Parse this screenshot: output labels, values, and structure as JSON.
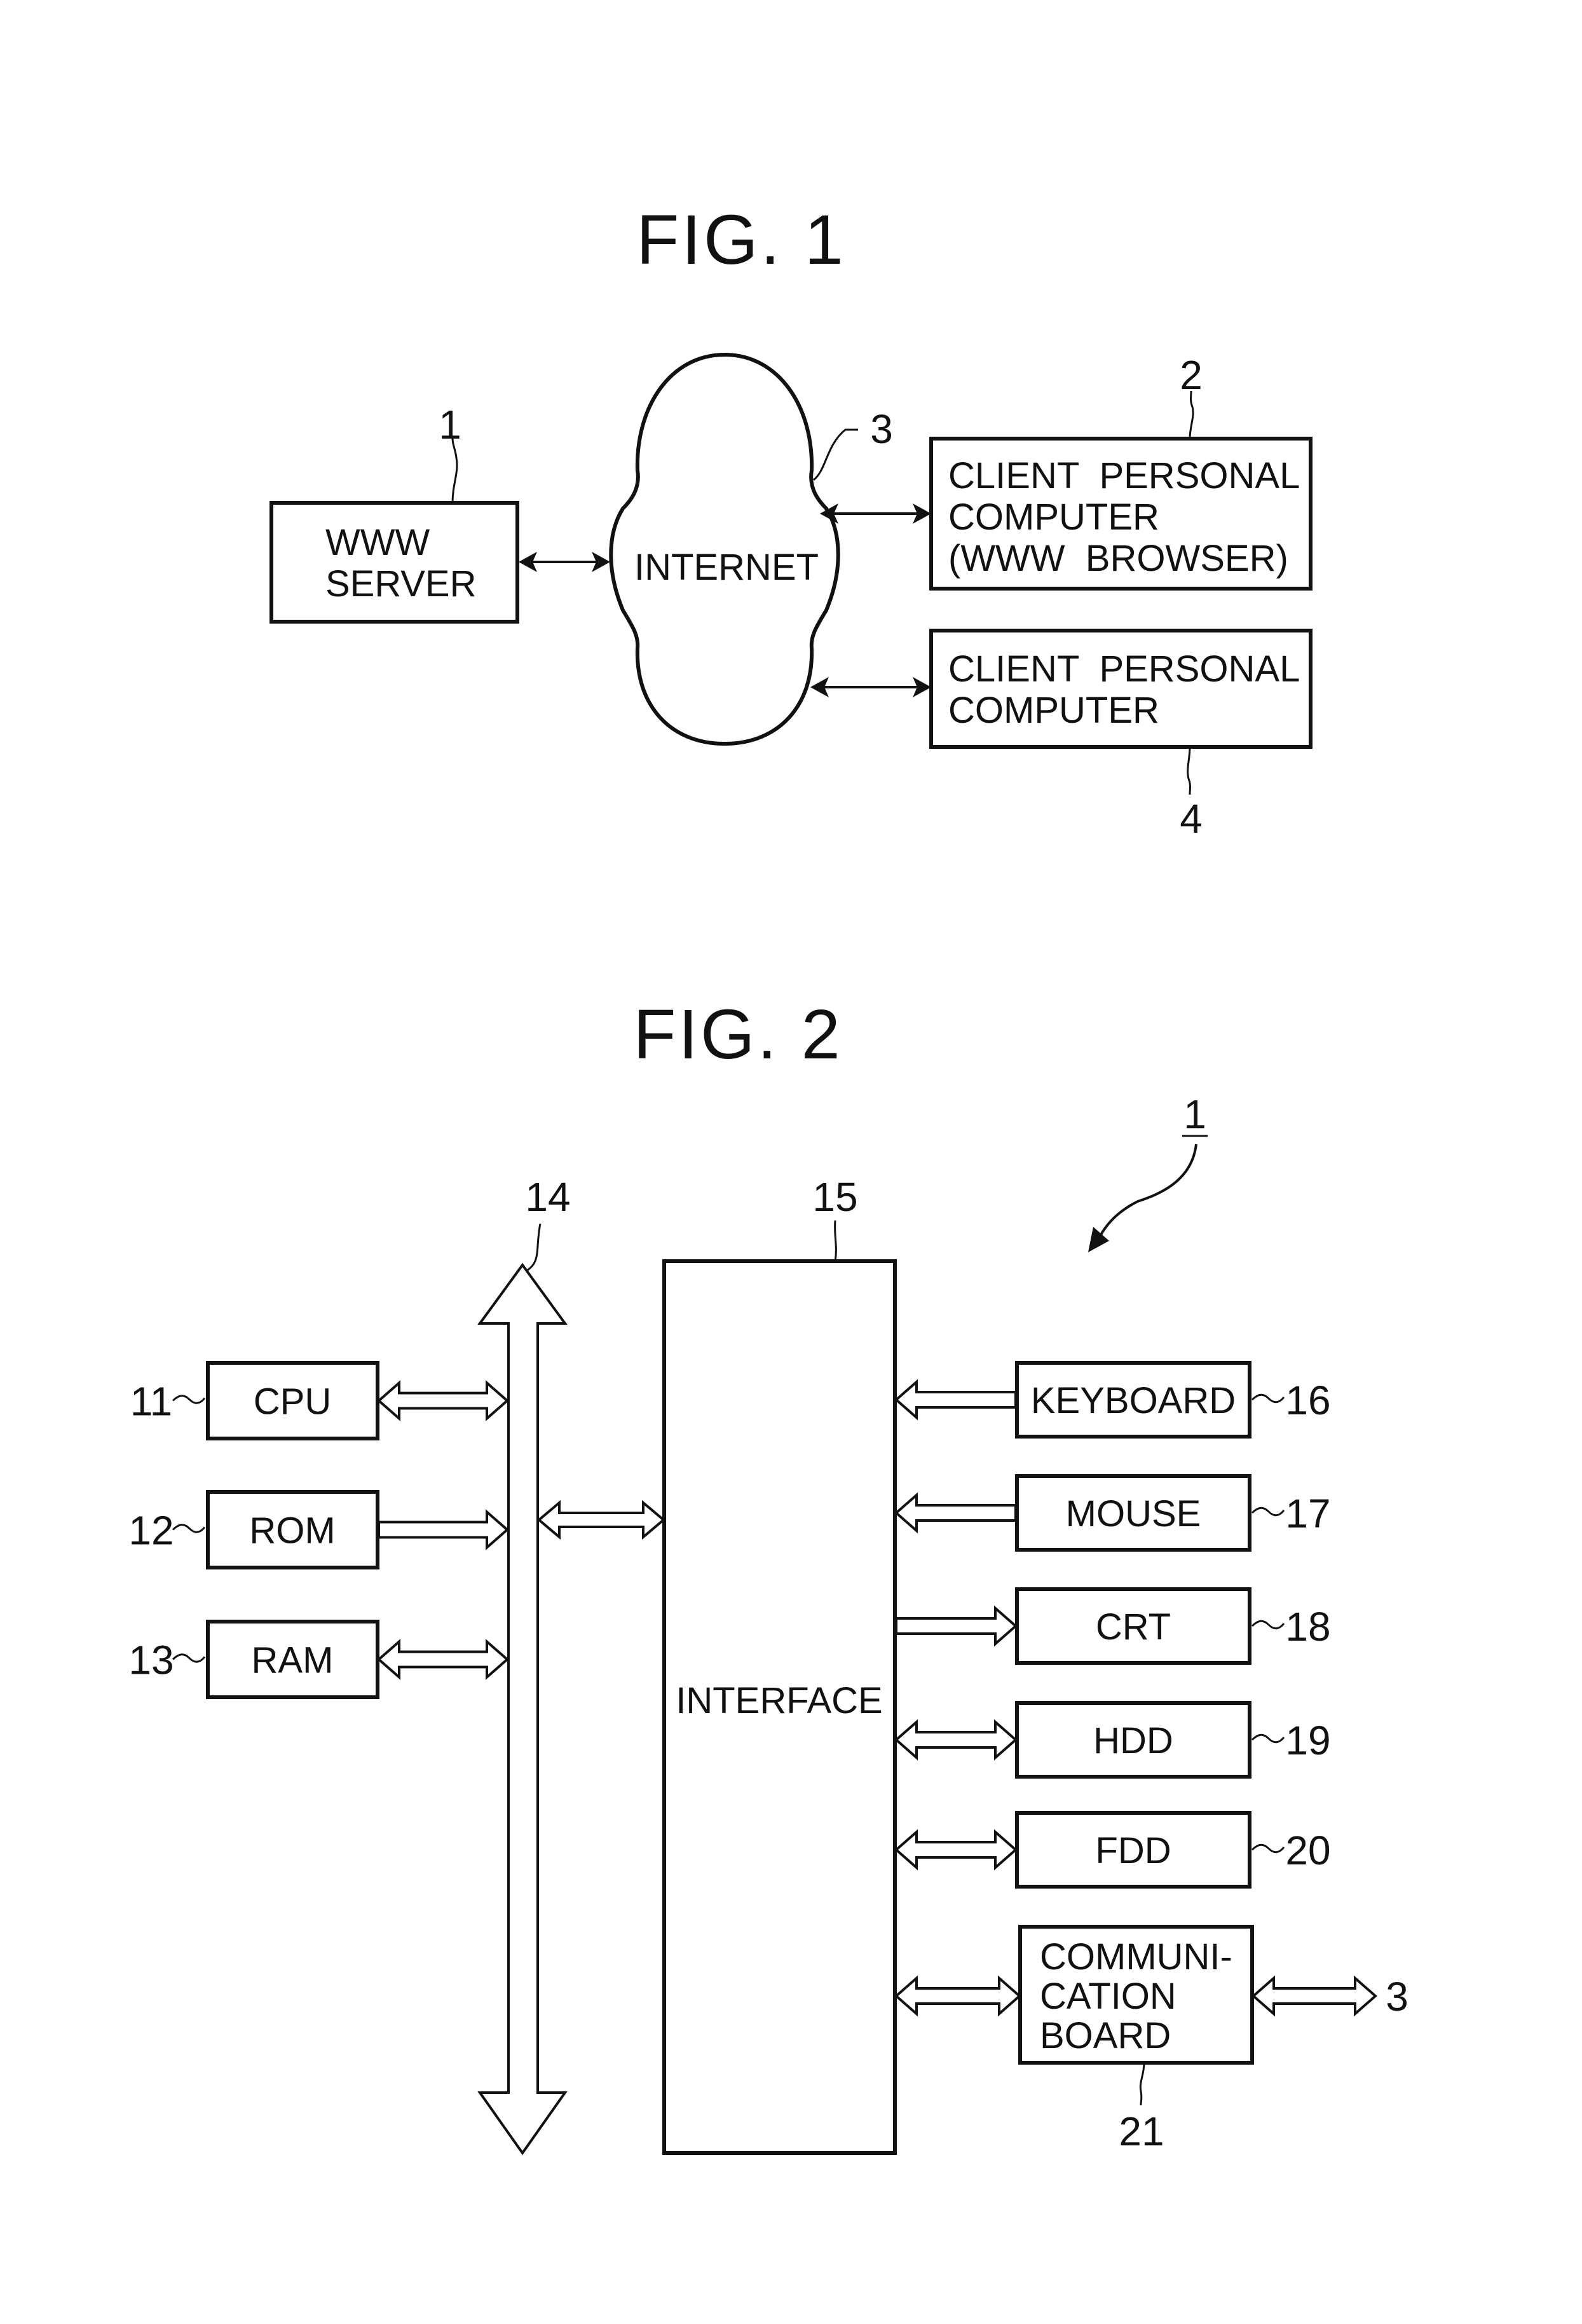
{
  "fig1": {
    "title": "FIG. 1",
    "server": {
      "ref": "1",
      "lines": [
        "WWW",
        "SERVER"
      ]
    },
    "internet": {
      "ref": "3",
      "label": "INTERNET"
    },
    "client1": {
      "ref": "2",
      "lines": [
        "CLIENT  PERSONAL",
        "COMPUTER",
        "(WWW  BROWSER)"
      ]
    },
    "client2": {
      "ref": "4",
      "lines": [
        "CLIENT  PERSONAL",
        "COMPUTER"
      ]
    }
  },
  "fig2": {
    "title": "FIG. 2",
    "device_ref": "1",
    "bus_ref": "14",
    "interface": {
      "ref": "15",
      "label": "INTERFACE"
    },
    "left_units": [
      {
        "ref": "11",
        "label": "CPU",
        "arrow": "bidirectional"
      },
      {
        "ref": "12",
        "label": "ROM",
        "arrow": "to-bus"
      },
      {
        "ref": "13",
        "label": "RAM",
        "arrow": "bidirectional"
      }
    ],
    "right_units": [
      {
        "ref": "16",
        "label": "KEYBOARD",
        "arrow": "to-interface"
      },
      {
        "ref": "17",
        "label": "MOUSE",
        "arrow": "to-interface"
      },
      {
        "ref": "18",
        "label": "CRT",
        "arrow": "from-interface"
      },
      {
        "ref": "19",
        "label": "HDD",
        "arrow": "bidirectional"
      },
      {
        "ref": "20",
        "label": "FDD",
        "arrow": "bidirectional"
      }
    ],
    "comm_board": {
      "ref": "21",
      "lines": [
        "COMMUNI-",
        "CATION",
        "BOARD"
      ],
      "external_ref": "3"
    }
  }
}
